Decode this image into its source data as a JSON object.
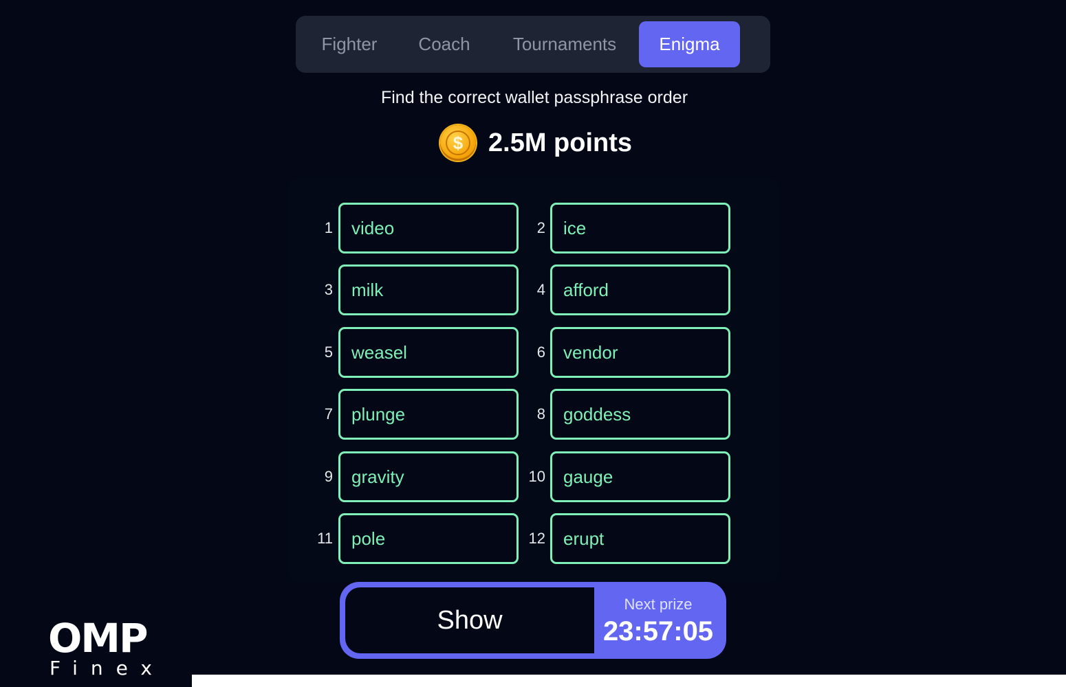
{
  "tabs": [
    {
      "label": "Fighter",
      "active": false
    },
    {
      "label": "Coach",
      "active": false
    },
    {
      "label": "Tournaments",
      "active": false
    },
    {
      "label": "Enigma",
      "active": true
    }
  ],
  "header": {
    "subtitle": "Find the correct wallet passphrase order",
    "points": "2.5M points",
    "coin_symbol": "$"
  },
  "words": [
    {
      "num": "1",
      "word": "video"
    },
    {
      "num": "2",
      "word": "ice"
    },
    {
      "num": "3",
      "word": "milk"
    },
    {
      "num": "4",
      "word": "afford"
    },
    {
      "num": "5",
      "word": "weasel"
    },
    {
      "num": "6",
      "word": "vendor"
    },
    {
      "num": "7",
      "word": "plunge"
    },
    {
      "num": "8",
      "word": "goddess"
    },
    {
      "num": "9",
      "word": "gravity"
    },
    {
      "num": "10",
      "word": "gauge"
    },
    {
      "num": "11",
      "word": "pole"
    },
    {
      "num": "12",
      "word": "erupt"
    }
  ],
  "action": {
    "show_label": "Show",
    "next_prize_label": "Next prize",
    "timer": "23:57:05"
  },
  "logo": {
    "main": "OMP",
    "sub": "Finex"
  },
  "colors": {
    "background": "#030716",
    "accent": "#6366f1",
    "word_green": "#7ff0b8",
    "tab_bar": "#1e2433"
  }
}
